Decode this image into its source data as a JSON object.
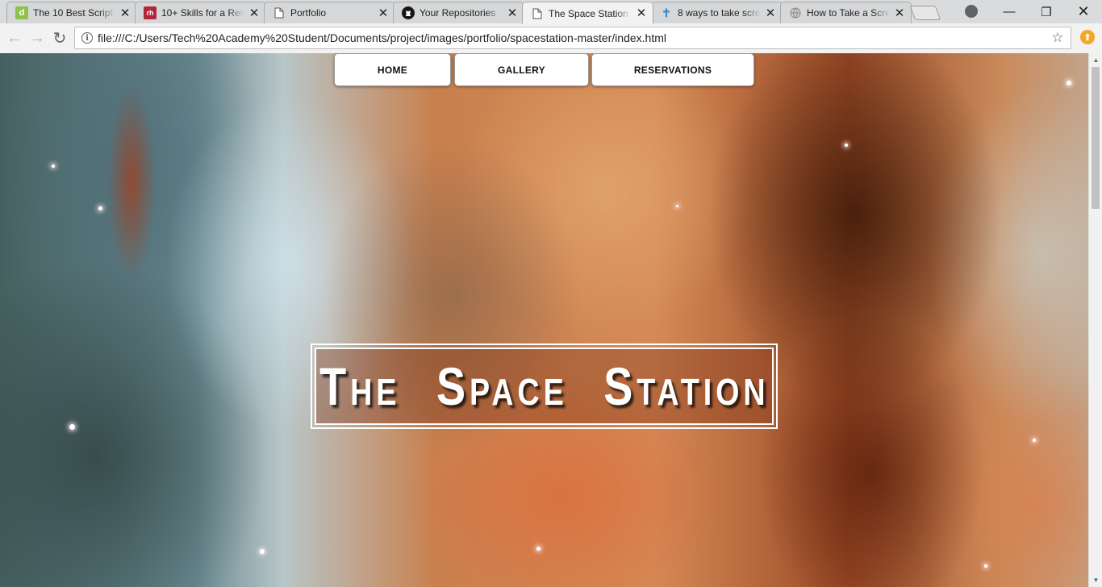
{
  "browser": {
    "tabs": [
      {
        "title": "The 10 Best Script",
        "favicon": "d-logo-icon",
        "favicon_text": "d",
        "favicon_color": "#8bc34a"
      },
      {
        "title": "10+ Skills for a Res",
        "favicon": "rh-logo-icon",
        "favicon_text": "rh",
        "favicon_color": "#b3263a"
      },
      {
        "title": "Portfolio",
        "favicon": "document-icon"
      },
      {
        "title": "Your Repositories",
        "favicon": "github-icon"
      },
      {
        "title": "The Space Station",
        "favicon": "document-icon",
        "active": true
      },
      {
        "title": "8 ways to take scre",
        "favicon": "cross-icon"
      },
      {
        "title": "How to Take a Scre",
        "favicon": "globe-icon"
      }
    ],
    "url": "file:///C:/Users/Tech%20Academy%20Student/Documents/project/images/portfolio/spacestation-master/index.html"
  },
  "site": {
    "nav": {
      "home": "HOME",
      "gallery": "GALLERY",
      "reservations": "RESERVATIONS"
    },
    "title": "The Space Station"
  }
}
